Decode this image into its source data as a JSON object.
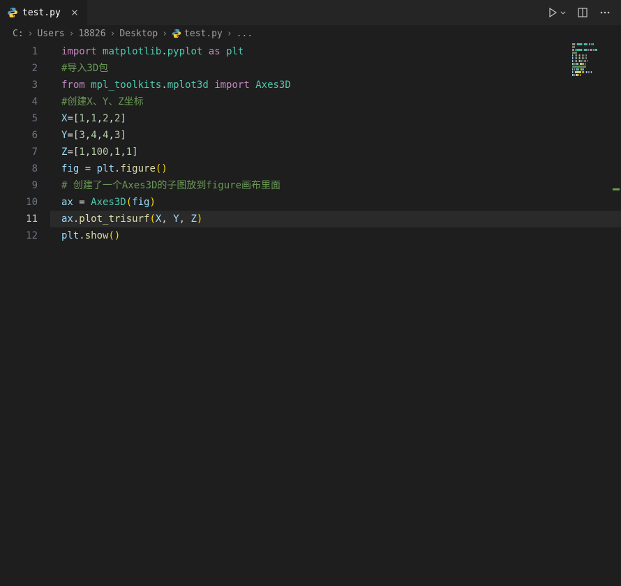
{
  "tab": {
    "filename": "test.py",
    "icon": "python-file-icon"
  },
  "actions": {
    "run": "run-icon",
    "run_chevron": "chevron-down-icon",
    "split": "split-editor-icon",
    "more": "more-icon"
  },
  "breadcrumb": {
    "parts": [
      "C:",
      "Users",
      "18826",
      "Desktop",
      "test.py",
      "..."
    ],
    "file_icon": "python-file-icon"
  },
  "code": {
    "active_line": 11,
    "lines": [
      {
        "n": 1,
        "tokens": [
          [
            "kw",
            "import"
          ],
          [
            "op",
            " "
          ],
          [
            "mod",
            "matplotlib"
          ],
          [
            "punc",
            "."
          ],
          [
            "mod",
            "pyplot"
          ],
          [
            "op",
            " "
          ],
          [
            "as",
            "as"
          ],
          [
            "op",
            " "
          ],
          [
            "mod",
            "plt"
          ]
        ]
      },
      {
        "n": 2,
        "tokens": [
          [
            "com",
            "#导入3D包"
          ]
        ]
      },
      {
        "n": 3,
        "tokens": [
          [
            "kw",
            "from"
          ],
          [
            "op",
            " "
          ],
          [
            "mod",
            "mpl_toolkits"
          ],
          [
            "punc",
            "."
          ],
          [
            "mod",
            "mplot3d"
          ],
          [
            "op",
            " "
          ],
          [
            "kw",
            "import"
          ],
          [
            "op",
            " "
          ],
          [
            "cls",
            "Axes3D"
          ]
        ]
      },
      {
        "n": 4,
        "tokens": [
          [
            "com",
            "#创建X、Y、Z坐标"
          ]
        ]
      },
      {
        "n": 5,
        "tokens": [
          [
            "var",
            "X"
          ],
          [
            "op",
            "="
          ],
          [
            "punc",
            "["
          ],
          [
            "num",
            "1"
          ],
          [
            "punc",
            ","
          ],
          [
            "num",
            "1"
          ],
          [
            "punc",
            ","
          ],
          [
            "num",
            "2"
          ],
          [
            "punc",
            ","
          ],
          [
            "num",
            "2"
          ],
          [
            "punc",
            "]"
          ]
        ]
      },
      {
        "n": 6,
        "tokens": [
          [
            "var",
            "Y"
          ],
          [
            "op",
            "="
          ],
          [
            "punc",
            "["
          ],
          [
            "num",
            "3"
          ],
          [
            "punc",
            ","
          ],
          [
            "num",
            "4"
          ],
          [
            "punc",
            ","
          ],
          [
            "num",
            "4"
          ],
          [
            "punc",
            ","
          ],
          [
            "num",
            "3"
          ],
          [
            "punc",
            "]"
          ]
        ]
      },
      {
        "n": 7,
        "tokens": [
          [
            "var",
            "Z"
          ],
          [
            "op",
            "="
          ],
          [
            "punc",
            "["
          ],
          [
            "num",
            "1"
          ],
          [
            "punc",
            ","
          ],
          [
            "num",
            "100"
          ],
          [
            "punc",
            ","
          ],
          [
            "num",
            "1"
          ],
          [
            "punc",
            ","
          ],
          [
            "num",
            "1"
          ],
          [
            "punc",
            "]"
          ]
        ]
      },
      {
        "n": 8,
        "tokens": [
          [
            "var",
            "fig"
          ],
          [
            "op",
            " = "
          ],
          [
            "ident",
            "plt"
          ],
          [
            "punc",
            "."
          ],
          [
            "fn",
            "figure"
          ],
          [
            "par",
            "("
          ],
          [
            "par",
            ")"
          ]
        ]
      },
      {
        "n": 9,
        "tokens": [
          [
            "com",
            "# 创建了一个Axes3D的子图放到figure画布里面"
          ]
        ]
      },
      {
        "n": 10,
        "tokens": [
          [
            "var",
            "ax"
          ],
          [
            "op",
            " = "
          ],
          [
            "cls",
            "Axes3D"
          ],
          [
            "par",
            "("
          ],
          [
            "ident",
            "fig"
          ],
          [
            "par",
            ")"
          ]
        ]
      },
      {
        "n": 11,
        "tokens": [
          [
            "ident",
            "ax"
          ],
          [
            "punc",
            "."
          ],
          [
            "fn",
            "plot_trisurf"
          ],
          [
            "par",
            "("
          ],
          [
            "ident",
            "X"
          ],
          [
            "punc",
            ", "
          ],
          [
            "ident",
            "Y"
          ],
          [
            "punc",
            ", "
          ],
          [
            "ident",
            "Z"
          ],
          [
            "par",
            ")"
          ]
        ]
      },
      {
        "n": 12,
        "tokens": [
          [
            "ident",
            "plt"
          ],
          [
            "punc",
            "."
          ],
          [
            "fn",
            "show"
          ],
          [
            "par",
            "("
          ],
          [
            "par",
            ")"
          ]
        ]
      }
    ]
  },
  "minimap": {
    "icon": "minimap"
  }
}
